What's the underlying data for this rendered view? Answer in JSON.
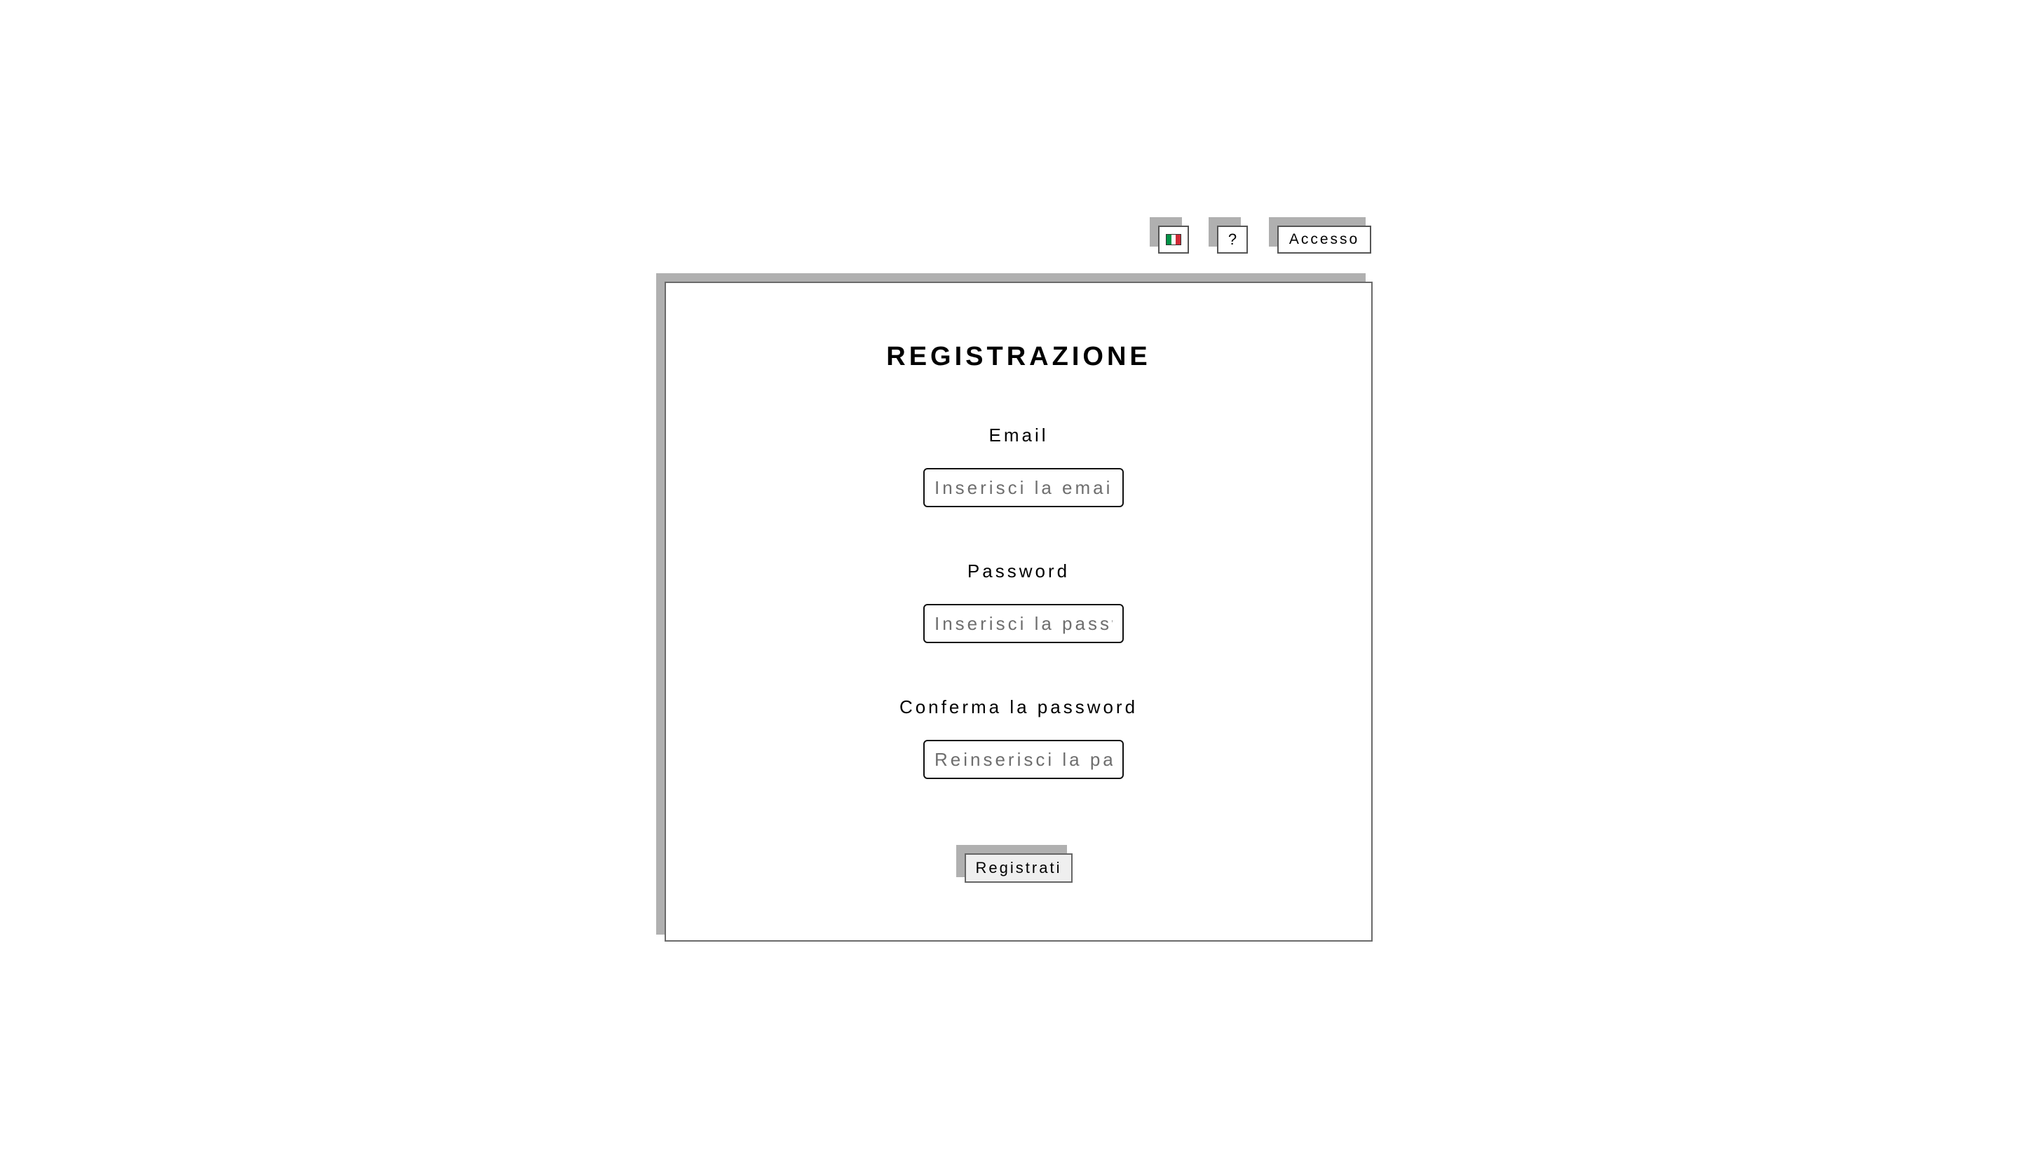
{
  "header": {
    "language_button": {
      "icon": "italian-flag-icon"
    },
    "help_button": {
      "label": "?"
    },
    "login_button": {
      "label": "Accesso"
    }
  },
  "form": {
    "title": "REGISTRAZIONE",
    "email": {
      "label": "Email",
      "placeholder": "Inserisci la email",
      "value": ""
    },
    "password": {
      "label": "Password",
      "placeholder": "Inserisci la password",
      "value": ""
    },
    "confirm_password": {
      "label": "Conferma la password",
      "placeholder": "Reinserisci la password",
      "value": ""
    },
    "submit_label": "Registrati"
  },
  "colors": {
    "shadow": "#b0b0b0",
    "border": "#6a6a6a",
    "flag_green": "#009246",
    "flag_white": "#ffffff",
    "flag_red": "#ce2b37"
  }
}
